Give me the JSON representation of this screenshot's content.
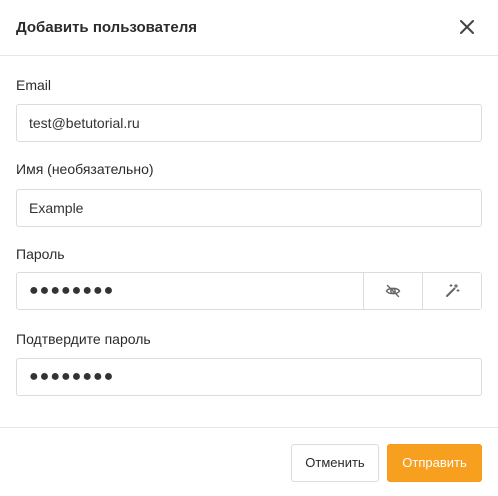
{
  "dialog": {
    "title": "Добавить пользователя",
    "close_icon": "close-icon"
  },
  "form": {
    "email": {
      "label": "Email",
      "value": "test@betutorial.ru"
    },
    "name": {
      "label": "Имя (необязательно)",
      "value": "Example"
    },
    "password": {
      "label": "Пароль",
      "value": "●●●●●●●●",
      "toggle_icon": "eye-off-icon",
      "generate_icon": "magic-wand-icon"
    },
    "confirm_password": {
      "label": "Подтвердите пароль",
      "value": "●●●●●●●●"
    }
  },
  "footer": {
    "cancel_label": "Отменить",
    "submit_label": "Отправить"
  },
  "colors": {
    "accent": "#f7a020",
    "border": "#dcdcdc",
    "text": "#2b2b2b"
  }
}
